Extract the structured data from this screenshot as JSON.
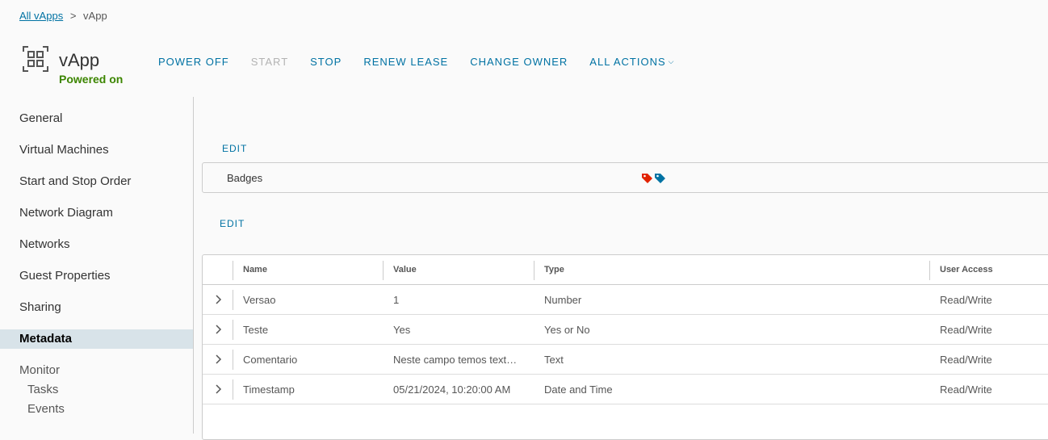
{
  "breadcrumb": {
    "parent": "All vApps",
    "separator": ">",
    "current": "vApp"
  },
  "header": {
    "title": "vApp",
    "status": "Powered on",
    "status_color": "#3c8500",
    "icon": "vapp-icon"
  },
  "actions": [
    {
      "label": "POWER OFF",
      "enabled": true
    },
    {
      "label": "START",
      "enabled": false
    },
    {
      "label": "STOP",
      "enabled": true
    },
    {
      "label": "RENEW LEASE",
      "enabled": true
    },
    {
      "label": "CHANGE OWNER",
      "enabled": true
    },
    {
      "label": "ALL ACTIONS",
      "enabled": true,
      "icon": "chevron-down-icon"
    }
  ],
  "sidebar": {
    "items": [
      {
        "label": "General"
      },
      {
        "label": "Virtual Machines"
      },
      {
        "label": "Start and Stop Order"
      },
      {
        "label": "Network Diagram"
      },
      {
        "label": "Networks"
      },
      {
        "label": "Guest Properties"
      },
      {
        "label": "Sharing"
      },
      {
        "label": "Metadata",
        "active": true
      }
    ],
    "monitor": {
      "label": "Monitor",
      "children": [
        {
          "label": "Tasks"
        },
        {
          "label": "Events"
        }
      ]
    }
  },
  "badges_section": {
    "edit_label": "EDIT",
    "label": "Badges",
    "tags": [
      {
        "icon": "tag-icon",
        "color": "#e12200"
      },
      {
        "icon": "tag-icon",
        "color": "#0072a3"
      }
    ]
  },
  "metadata_section": {
    "edit_label": "EDIT",
    "columns": [
      "Name",
      "Value",
      "Type",
      "User Access"
    ],
    "rows": [
      {
        "name": "Versao",
        "value": "1",
        "type": "Number",
        "access": "Read/Write"
      },
      {
        "name": "Teste",
        "value": "Yes",
        "type": "Yes or No",
        "access": "Read/Write"
      },
      {
        "name": "Comentario",
        "value": "Neste campo temos text…",
        "type": "Text",
        "access": "Read/Write"
      },
      {
        "name": "Timestamp",
        "value": "05/21/2024, 10:20:00 AM",
        "type": "Date and Time",
        "access": "Read/Write"
      }
    ]
  },
  "colors": {
    "link": "#0072a3",
    "active_nav_bg": "#d8e3e9"
  }
}
